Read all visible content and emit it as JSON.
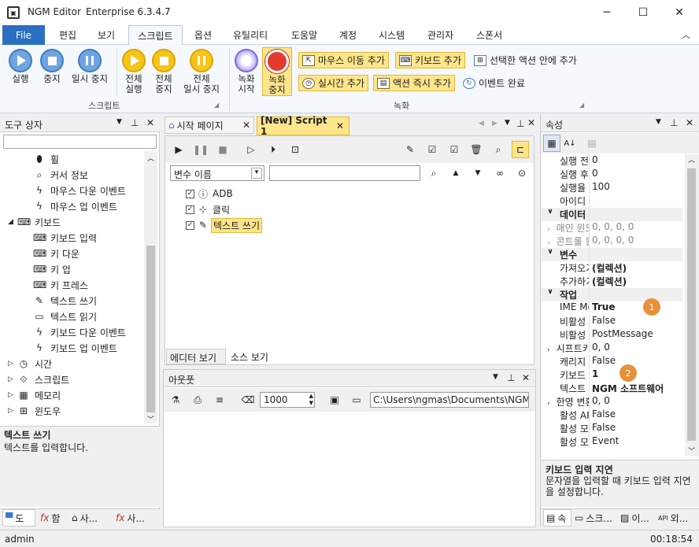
{
  "app": {
    "title": "NGM Editor",
    "edition": "Enterprise 6.3.4.7"
  },
  "window": {
    "minimize": "─",
    "maximize": "☐",
    "close": "✕"
  },
  "menu": {
    "file": "File",
    "items": [
      "편집",
      "보기",
      "스크립트",
      "옵션",
      "유틸리티",
      "도움말",
      "계정",
      "시스템",
      "관리자",
      "스폰서"
    ]
  },
  "ribbon": {
    "run": "실행",
    "stop": "중지",
    "pause": "일시 중지",
    "all_run": [
      "전체",
      "실행"
    ],
    "all_stop": [
      "전체",
      "중지"
    ],
    "all_pause": [
      "전체",
      "일시 중지"
    ],
    "script_group": "스크립트",
    "record_start": [
      "녹화",
      "시작"
    ],
    "record_stop": [
      "녹화",
      "중지"
    ],
    "add_mouse_move": "마우스 이동 추가",
    "add_keyboard": "키보드 추가",
    "inside_selected": "선택한 액션 안에 추가",
    "add_realtime": "실시간 추가",
    "add_action_now": "액션 즉시 추가",
    "event_done": "이벤트 완료",
    "record_group": "녹화"
  },
  "toolbox": {
    "title": "도구 상자",
    "items": [
      {
        "icon": "mouse-icon",
        "label": "휠"
      },
      {
        "icon": "cursor-info-icon",
        "label": "커서 정보"
      },
      {
        "icon": "lightning-icon",
        "label": "마우스 다운 이벤트"
      },
      {
        "icon": "lightning-icon",
        "label": "마우스 업 이벤트"
      },
      {
        "icon": "keyboard-icon",
        "label": "키보드"
      },
      {
        "icon": "keyboard-icon",
        "label": "키보드 입력"
      },
      {
        "icon": "key-down-icon",
        "label": "키 다운"
      },
      {
        "icon": "key-up-icon",
        "label": "키 업"
      },
      {
        "icon": "key-press-icon",
        "label": "키 프레스"
      },
      {
        "icon": "write-text-icon",
        "label": "텍스트 쓰기"
      },
      {
        "icon": "read-text-icon",
        "label": "텍스트 읽기"
      },
      {
        "icon": "lightning-icon",
        "label": "키보드 다운 이벤트"
      },
      {
        "icon": "lightning-icon",
        "label": "키보드 업 이벤트"
      },
      {
        "icon": "clock-icon",
        "label": "시간"
      },
      {
        "icon": "script-icon",
        "label": "스크립트"
      },
      {
        "icon": "memory-icon",
        "label": "메모리"
      },
      {
        "icon": "windows-icon",
        "label": "윈도우"
      }
    ],
    "desc_title": "텍스트 쓰기",
    "desc_text": "텍스트를 입력합니다.",
    "bottom_tabs": [
      "도",
      "함",
      "사...",
      "사..."
    ]
  },
  "editor": {
    "tabs": [
      "시작 페이지",
      "[New] Script 1"
    ],
    "var_select": "변수 이름",
    "nodes": [
      "ADB",
      "클릭",
      "텍스트 쓰기"
    ],
    "view_tabs": [
      "에디터 보기",
      "소스 보기"
    ]
  },
  "output": {
    "title": "아웃풋",
    "count": "1000",
    "path": "C:\\Users\\ngmas\\Documents\\NGM6\\"
  },
  "properties": {
    "title": "속성",
    "rows": [
      {
        "n": "실행 전 지",
        "v": "0"
      },
      {
        "n": "실행 후 지",
        "v": "0"
      },
      {
        "n": "실행율",
        "v": "100"
      },
      {
        "n": "아이디",
        "v": ""
      },
      {
        "cat": "데이터"
      },
      {
        "n": "매인 윈도!",
        "v": "0, 0, 0, 0",
        "dim": true
      },
      {
        "n": "콘트롤 윈!",
        "v": "0, 0, 0, 0",
        "dim": true
      },
      {
        "cat": "변수"
      },
      {
        "n": "가져오기",
        "v": "(컬렉션)",
        "b": true
      },
      {
        "n": "추가하기",
        "v": "(컬렉션)",
        "b": true
      },
      {
        "cat": "작업"
      },
      {
        "n": "IME Mode",
        "v": "True",
        "b": true
      },
      {
        "n": "비활성 모!",
        "v": "False"
      },
      {
        "n": "비활성 모!",
        "v": "PostMessage"
      },
      {
        "n": "시프트키 :",
        "v": "0, 0"
      },
      {
        "n": "캐리지 리!",
        "v": "False"
      },
      {
        "n": "키보드 입!",
        "v": "1",
        "b": true
      },
      {
        "n": "텍스트",
        "v": "NGM 소프트웨어",
        "b": true
      },
      {
        "n": "한영 변환:",
        "v": "0, 0"
      },
      {
        "n": "활성 API /",
        "v": "False"
      },
      {
        "n": "활성 모드",
        "v": "False"
      },
      {
        "n": "활성 모드",
        "v": "Event"
      }
    ],
    "badges": [
      "1",
      "2"
    ],
    "desc_title": "키보드 입력 지연",
    "desc_text": "문자열을 입력할 때 키보드 입력 지연을 설정합니다.",
    "bottom_tabs": [
      "속",
      "스크...",
      "이...",
      "외..."
    ]
  },
  "status": {
    "user": "admin",
    "time": "00:18:54"
  },
  "colors": {
    "accent": "#2b6fc2",
    "highlight": "#fde58a",
    "badge": "#e8913a"
  }
}
